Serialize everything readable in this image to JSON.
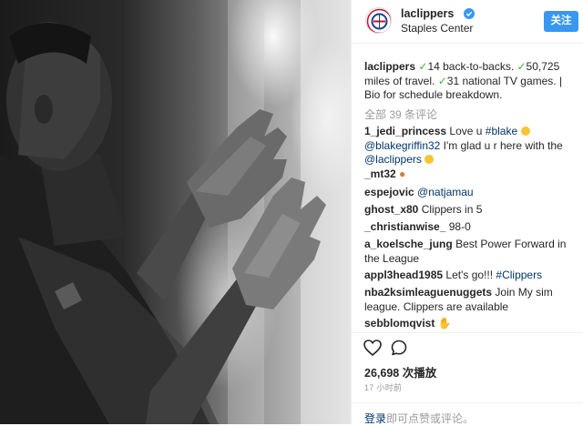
{
  "header": {
    "username": "laclippers",
    "location": "Staples Center",
    "follow_label": "关注"
  },
  "caption": {
    "username": "laclippers",
    "check": "✓",
    "t1": "14 back-to-backs. ",
    "t2": "50,725 miles of travel. ",
    "t3": "31 national TV games. | Bio for schedule breakdown."
  },
  "view_all_comments": "全部 39 条评论",
  "comments": [
    {
      "user": "1_jedi_princess",
      "t1": "Love u ",
      "tag": "#blake",
      "m1": "@blakegriffin32",
      "t2": " I'm glad u r here with the ",
      "m2": "@laclippers"
    },
    {
      "user": "_mt32"
    },
    {
      "user": "espejovic",
      "mention": "@natjamau"
    },
    {
      "user": "ghost_x80",
      "text": "Clippers in 5"
    },
    {
      "user": "_christianwise_",
      "text": "98-0"
    },
    {
      "user": "a_koelsche_jung",
      "text": "Best Power Forward in the League"
    },
    {
      "user": "appl3head1985",
      "text": "Let's go!!! ",
      "tag": "#Clippers"
    },
    {
      "user": "nba2ksimleaguenuggets",
      "text": "Join My sim league. Clippers are available"
    },
    {
      "user": "sebblomqvist"
    }
  ],
  "icons": [
    "heart-icon",
    "comment-icon",
    "verified-badge-icon",
    "clippers-logo"
  ],
  "stats": {
    "views": "26,698 次播放",
    "time": "17 小时前"
  },
  "footer": {
    "login_label": "登录",
    "login_suffix": "即可点赞或评论。"
  },
  "colors": {
    "follow_button": "#3897f0",
    "link": "#003569",
    "check": "#3db53d",
    "muted": "#999999"
  }
}
